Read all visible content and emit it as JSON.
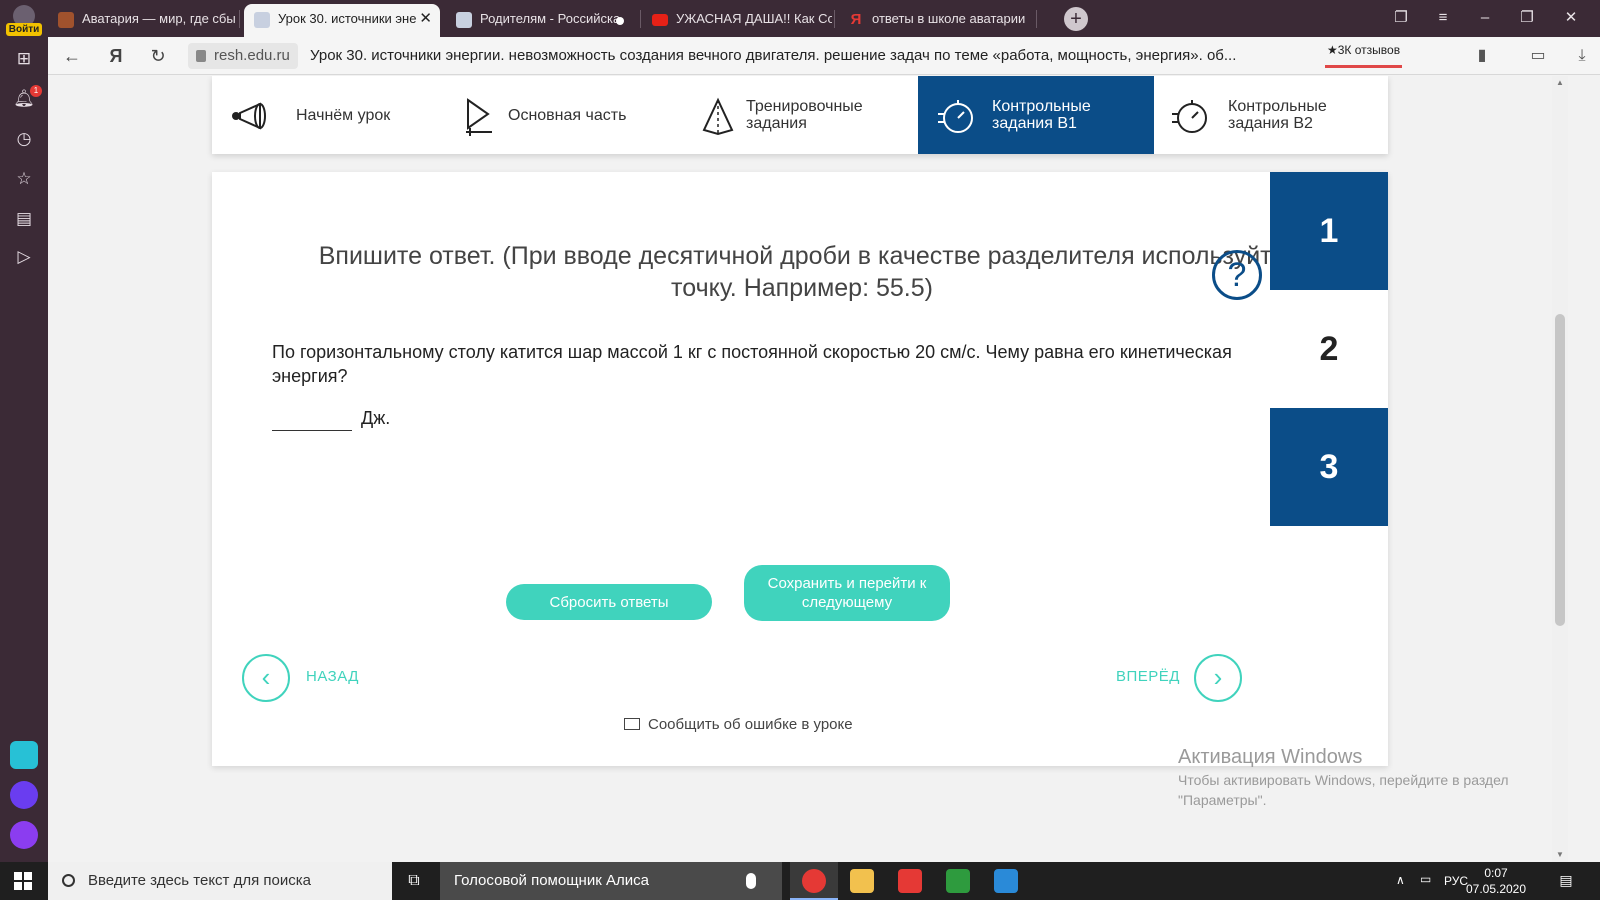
{
  "browser": {
    "profile_label": "Войти",
    "tabs": [
      {
        "title": "Аватария — мир, где сбы",
        "active": false
      },
      {
        "title": "Урок 30. источники эне",
        "active": true
      },
      {
        "title": "Родителям - Российска",
        "active": false
      },
      {
        "title": "УЖАСНАЯ ДАША!! Как Со",
        "active": false
      },
      {
        "title": "ответы в школе аватарии",
        "active": false
      }
    ],
    "url_host": "resh.edu.ru",
    "url_title": "Урок 30. источники энергии. невозможность создания вечного двигателя. решение задач по теме «работа, мощность, энергия». об...",
    "reviews_label": "★3К отзывов",
    "notification_count": "1"
  },
  "lesson_nav": [
    {
      "label": "Начнём урок",
      "icon": "megaphone-icon",
      "active": false
    },
    {
      "label": "Основная часть",
      "icon": "play-icon",
      "active": false
    },
    {
      "label": "Тренировочные задания",
      "icon": "pyramid-icon",
      "active": false
    },
    {
      "label": "Контрольные задания В1",
      "icon": "stopwatch-icon",
      "active": true
    },
    {
      "label": "Контрольные задания В2",
      "icon": "stopwatch-icon",
      "active": false
    }
  ],
  "task": {
    "instruction": "Впишите ответ. (При вводе десятичной дроби в качестве разделителя используйте точку. Например: 55.5)",
    "help_symbol": "?",
    "question": "По горизонтальному столу катится шар массой 1 кг с постоянной скоростью 20 см/с. Чему равна его кинетическая энергия?",
    "answer_value": "",
    "answer_unit": "Дж."
  },
  "task_numbers": [
    {
      "label": "1",
      "filled": true
    },
    {
      "label": "2",
      "filled": false
    },
    {
      "label": "3",
      "filled": true
    }
  ],
  "buttons": {
    "reset": "Сбросить ответы",
    "save": "Сохранить и перейти к следующему",
    "back": "НАЗАД",
    "forward": "ВПЕРЁД",
    "report": "Сообщить об ошибке в уроке"
  },
  "watermark": {
    "title": "Активация Windows",
    "subtitle": "Чтобы активировать Windows, перейдите в раздел \"Параметры\"."
  },
  "taskbar": {
    "search_placeholder": "Введите здесь текст для поиска",
    "alice_label": "Голосовой помощник Алиса",
    "language": "РУС",
    "time": "0:07",
    "date": "07.05.2020"
  },
  "colors": {
    "brand_blue": "#0b4d88",
    "teal": "#40d3bd",
    "browser_frame": "#3b2a36"
  }
}
